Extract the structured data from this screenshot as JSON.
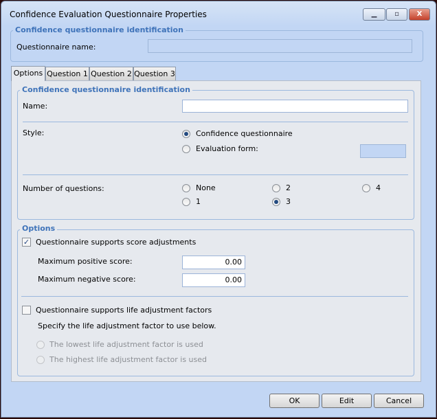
{
  "window": {
    "title": "Confidence Evaluation Questionnaire Properties",
    "minimize": "▁",
    "maximize": "▫",
    "close": "X"
  },
  "top_group": {
    "legend": "Confidence questionnaire identification",
    "name_label": "Questionnaire name:",
    "name_value": ""
  },
  "tabs": [
    "Options",
    "Question 1",
    "Question 2",
    "Question 3"
  ],
  "ident_group": {
    "legend": "Confidence questionnaire identification",
    "name_label": "Name:",
    "name_value": "",
    "style_label": "Style:",
    "style_options": [
      "Confidence questionnaire",
      "Evaluation form:"
    ],
    "style_selected": "Confidence questionnaire",
    "evaluation_value": "",
    "num_label": "Number of questions:",
    "num_options": [
      "None",
      "2",
      "4",
      "1",
      "3"
    ],
    "num_selected": "3"
  },
  "options_group": {
    "legend": "Options",
    "score_adj_label": "Questionnaire supports score adjustments",
    "score_adj_checked": true,
    "max_pos_label": "Maximum positive score:",
    "max_pos_value": "0.00",
    "max_neg_label": "Maximum negative score:",
    "max_neg_value": "0.00",
    "life_adj_label": "Questionnaire supports life adjustment factors",
    "life_adj_checked": false,
    "specify_text": "Specify the life adjustment factor to use below.",
    "life_options": [
      "The lowest life adjustment factor is used",
      "The highest life adjustment factor is used"
    ]
  },
  "buttons": {
    "ok": "OK",
    "edit": "Edit",
    "cancel": "Cancel"
  }
}
